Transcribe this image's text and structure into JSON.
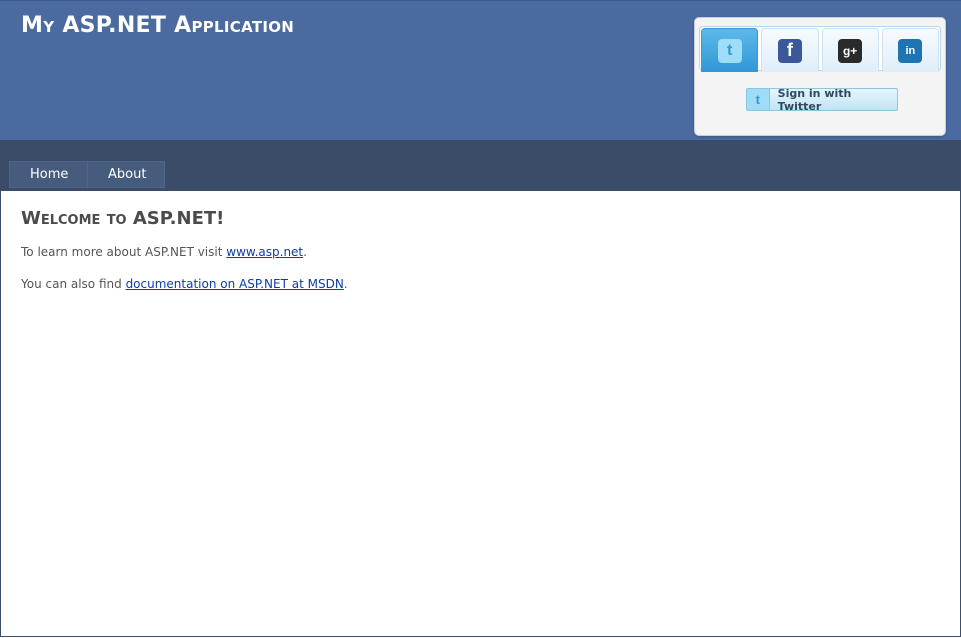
{
  "header": {
    "title": "My ASP.NET Application"
  },
  "social": {
    "tabs": [
      {
        "name": "twitter",
        "icon": "twitter-icon",
        "glyph": "t",
        "active": true
      },
      {
        "name": "facebook",
        "icon": "facebook-icon",
        "glyph": "f",
        "active": false
      },
      {
        "name": "google-plus",
        "icon": "google-plus-icon",
        "glyph": "g+",
        "active": false
      },
      {
        "name": "linkedin",
        "icon": "linkedin-icon",
        "glyph": "in",
        "active": false
      }
    ],
    "signin_icon_glyph": "t",
    "signin_label": "Sign in with Twitter"
  },
  "nav": {
    "items": [
      {
        "label": "Home"
      },
      {
        "label": "About"
      }
    ]
  },
  "main": {
    "heading": "Welcome to ASP.NET!",
    "p1_prefix": "To learn more about ASP.NET visit ",
    "p1_link": "www.asp.net",
    "p1_suffix": ".",
    "p2_prefix": "You can also find ",
    "p2_link": "documentation on ASP.NET at MSDN",
    "p2_suffix": "."
  },
  "colors": {
    "header_bg": "#4a6aa0",
    "nav_bg": "#3a4c68",
    "link": "#0b3ea8",
    "twitter_tab_active": "#2f97d6"
  }
}
